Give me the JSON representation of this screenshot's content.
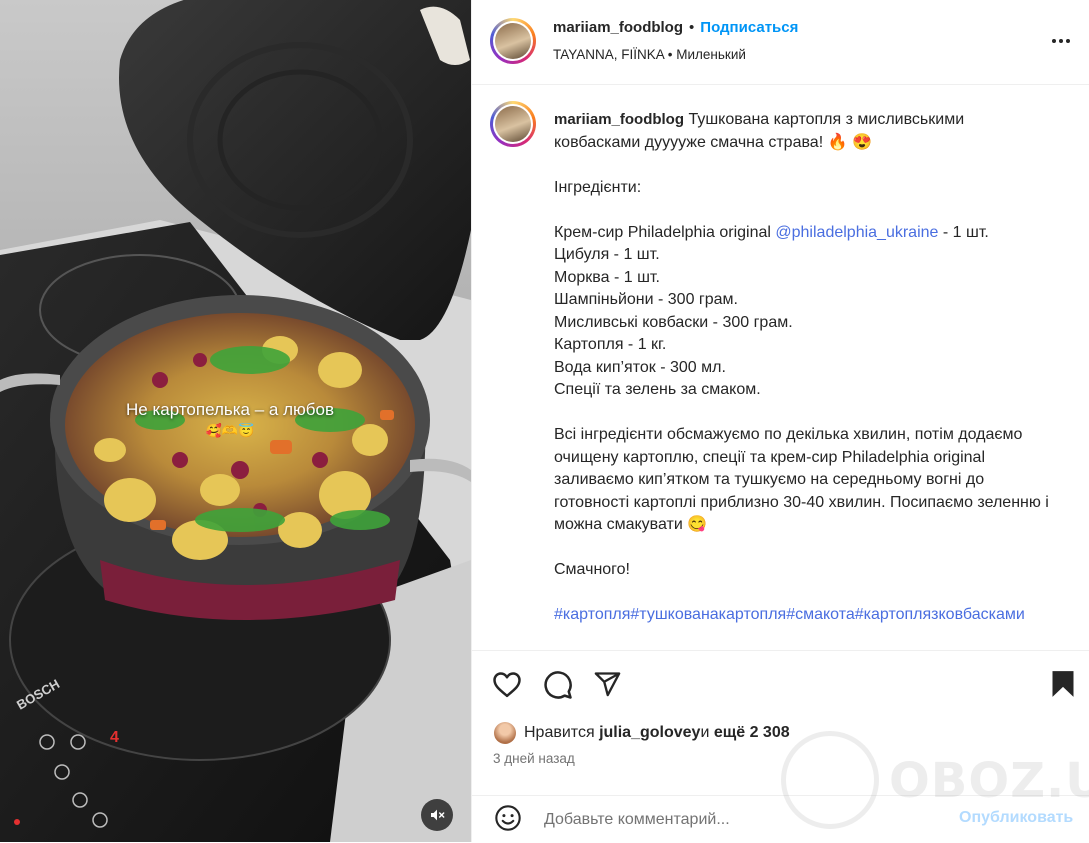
{
  "post": {
    "username": "mariiam_foodblog",
    "separator": "•",
    "follow_label": "Подписаться",
    "location_line": "TAYANNA, FIЇNKA • Миленький"
  },
  "media": {
    "overlay_text": "Не картопелька – а любов",
    "overlay_emoji": "🥰🫶😇",
    "stove_brand": "BOSCH",
    "burner_level": "4",
    "mute_icon": "speaker-muted-icon"
  },
  "caption": {
    "username": "mariiam_foodblog",
    "title_text": " Тушкована картопля з мисливськими ковбасками дууууже смачна страва! 🔥 😍",
    "ingredients_heading": "Інгредієнти:",
    "ingredient_1_prefix": "Крем-сир Philadelphia original ",
    "ingredient_1_mention": "@philadelphia_ukraine",
    "ingredient_1_suffix": " - 1 шт.",
    "ingredients": [
      "Цибуля - 1 шт.",
      "Морква - 1 шт.",
      "Шампіньйони - 300 грам.",
      "Мисливські ковбаски - 300 грам.",
      "Картопля - 1 кг.",
      "Вода кип’яток - 300 мл.",
      "Спеції та зелень за смаком."
    ],
    "method": "Всі інгредієнти обсмажуємо по декілька хвилин, потім додаємо очищену картоплю, спеції та крем-сир Philadelphia original заливаємо кип’ятком та тушкуємо на середньому вогні до готовності картоплі приблизно 30-40 хвилин. Посипаємо зеленню і можна смакувати 😋",
    "closing": "Смачного!",
    "hashtags": "#картопля#тушкованакартопля#смакота#картоплязковбасками"
  },
  "actions": {
    "like_icon": "heart-icon",
    "comment_icon": "comment-icon",
    "share_icon": "send-icon",
    "save_icon": "bookmark-icon"
  },
  "likes": {
    "prefix": "Нравится ",
    "user": "julia_golovey",
    "middle": " и ",
    "others": "ещё 2 308"
  },
  "time_ago": "3 дней назад",
  "comment": {
    "placeholder": "Добавьте комментарий...",
    "publish_label": "Опубликовать",
    "emoji_icon": "smiley-icon"
  },
  "watermark": {
    "text": "OBOZ.UA"
  },
  "colors": {
    "link_blue": "#0095f6",
    "hashtag_blue": "#4a6ee0",
    "text": "#262626",
    "muted": "#737373",
    "publish_disabled": "#b3dbff"
  }
}
